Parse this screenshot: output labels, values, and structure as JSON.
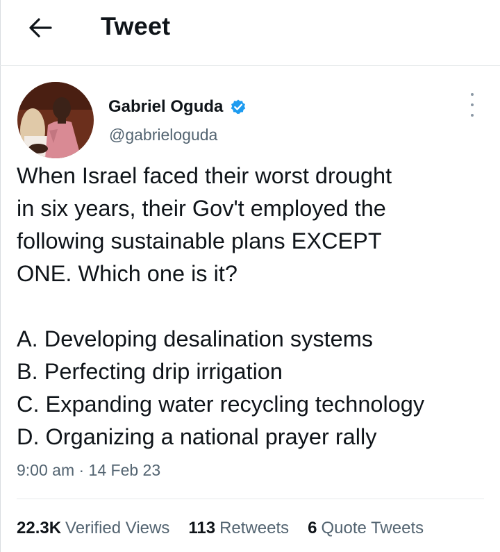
{
  "header": {
    "title": "Tweet",
    "back_icon": "arrow-left-icon"
  },
  "author": {
    "name": "Gabriel Oguda",
    "handle": "@gabrieloguda",
    "verified_icon": "verified-badge-icon",
    "verified_color": "#1d9bf0"
  },
  "tweet": {
    "lines": [
      "When Israel faced their worst drought",
      "in six years, their Gov't employed the",
      "following sustainable plans EXCEPT",
      "ONE. Which one is it?"
    ],
    "options": [
      "A. Developing desalination systems",
      "B. Perfecting drip irrigation",
      "C. Expanding water recycling technology",
      "D. Organizing a national prayer rally"
    ],
    "timestamp": "9:00 am · 14 Feb 23"
  },
  "stats": {
    "views_count": "22.3K",
    "views_label": "Verified Views",
    "retweets_count": "113",
    "retweets_label": "Retweets",
    "quotes_count": "6",
    "quotes_label": "Quote Tweets"
  },
  "more_icon": "more-vertical-icon"
}
